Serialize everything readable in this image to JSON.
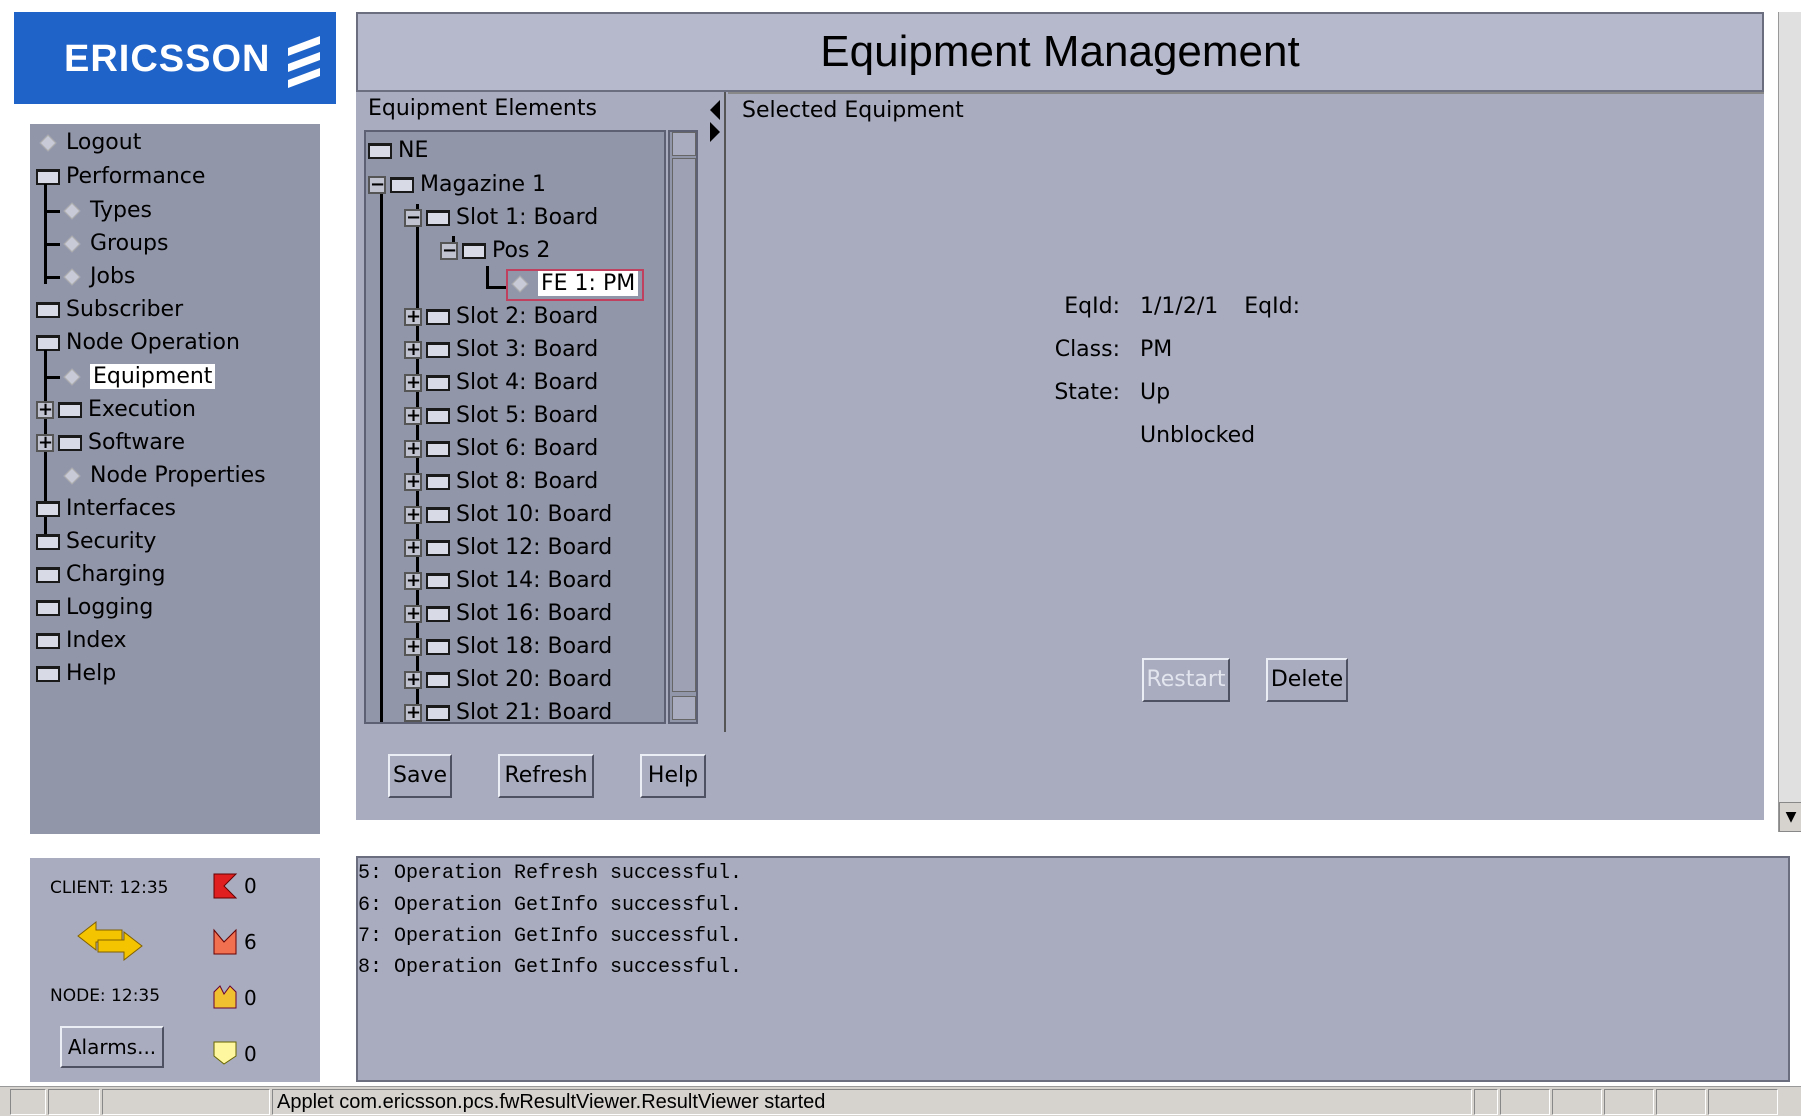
{
  "header": {
    "logo_text": "ERICSSON",
    "title": "Equipment Management"
  },
  "nav": {
    "items": [
      {
        "label": "Logout",
        "icon": "diamond-icon"
      },
      {
        "label": "Performance",
        "icon": "folder-icon"
      },
      {
        "label": "Types",
        "icon": "diamond-icon"
      },
      {
        "label": "Groups",
        "icon": "diamond-icon"
      },
      {
        "label": "Jobs",
        "icon": "diamond-icon"
      },
      {
        "label": "Subscriber",
        "icon": "folder-icon"
      },
      {
        "label": "Node Operation",
        "icon": "folder-icon"
      },
      {
        "label": "Equipment",
        "icon": "diamond-icon",
        "selected": true
      },
      {
        "label": "Execution",
        "icon": "folder-icon"
      },
      {
        "label": "Software",
        "icon": "folder-icon"
      },
      {
        "label": "Node Properties",
        "icon": "diamond-icon"
      },
      {
        "label": "Interfaces",
        "icon": "folder-icon"
      },
      {
        "label": "Security",
        "icon": "folder-icon"
      },
      {
        "label": "Charging",
        "icon": "folder-icon"
      },
      {
        "label": "Logging",
        "icon": "folder-icon"
      },
      {
        "label": "Index",
        "icon": "folder-icon"
      },
      {
        "label": "Help",
        "icon": "folder-icon"
      }
    ]
  },
  "equipment": {
    "elements_heading": "Equipment Elements",
    "selected_heading": "Selected Equipment",
    "tree": [
      {
        "label": "NE"
      },
      {
        "label": "Magazine 1"
      },
      {
        "label": "Slot 1: Board"
      },
      {
        "label": "Pos 2"
      },
      {
        "label": "FE 1: PM",
        "selected": true
      },
      {
        "label": "Slot 2: Board"
      },
      {
        "label": "Slot 3: Board"
      },
      {
        "label": "Slot 4: Board"
      },
      {
        "label": "Slot 5: Board"
      },
      {
        "label": "Slot 6: Board"
      },
      {
        "label": "Slot 8: Board"
      },
      {
        "label": "Slot 10: Board"
      },
      {
        "label": "Slot 12: Board"
      },
      {
        "label": "Slot 14: Board"
      },
      {
        "label": "Slot 16: Board"
      },
      {
        "label": "Slot 18: Board"
      },
      {
        "label": "Slot 20: Board"
      },
      {
        "label": "Slot 21: Board"
      }
    ],
    "details": {
      "eqid_label": "EqId:",
      "eqid_value": "1/1/2/1",
      "class_label": "Class:",
      "class_value": "PM",
      "state_label": "State:",
      "state_value": "Up",
      "state_value2": "Unblocked"
    },
    "restart_label": "Restart",
    "delete_label": "Delete",
    "save_label": "Save",
    "refresh_label": "Refresh",
    "help_label": "Help"
  },
  "status_panel": {
    "client": "CLIENT: 12:35",
    "node": "NODE: 12:35",
    "alarms_button": "Alarms...",
    "counts": {
      "critical": "0",
      "major": "6",
      "minor": "0",
      "warning": "0"
    },
    "colors": {
      "critical": "#e02020",
      "major": "#f07050",
      "minor": "#f0c030",
      "warning": "#fff6a0"
    }
  },
  "log": {
    "lines": [
      "5: Operation Refresh successful.",
      "6: Operation GetInfo successful.",
      "7: Operation GetInfo successful.",
      "8: Operation GetInfo successful."
    ]
  },
  "statusbar": {
    "message": "Applet com.ericsson.pcs.fwResultViewer.ResultViewer started"
  }
}
